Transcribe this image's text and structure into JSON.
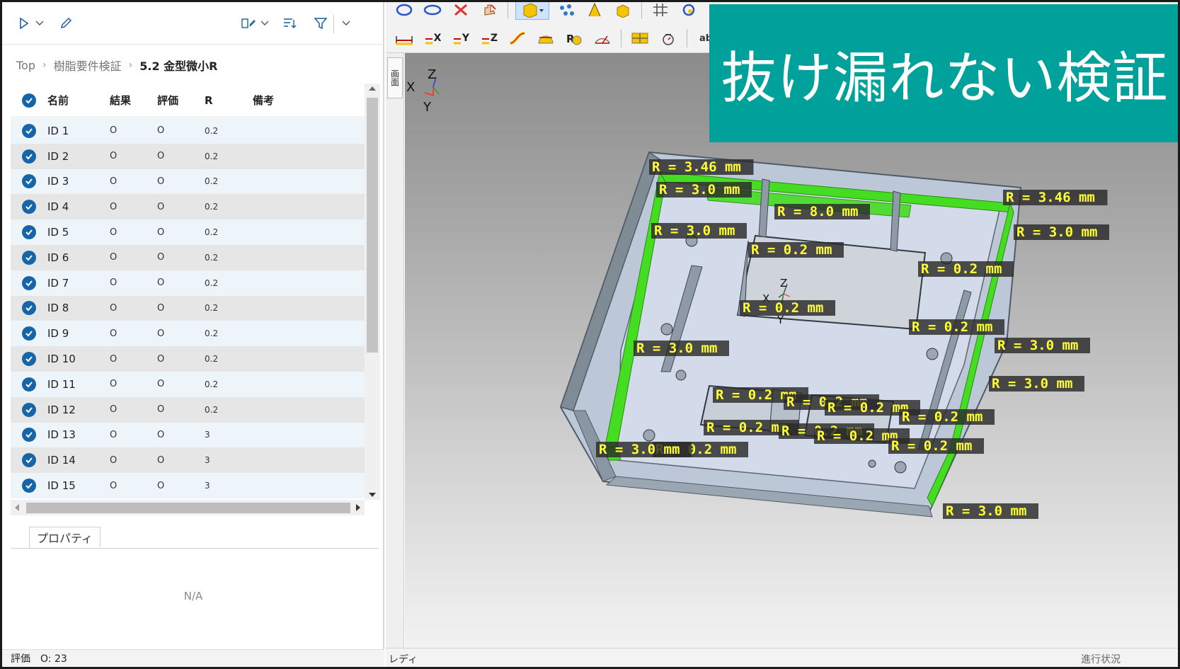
{
  "left_toolbar": {
    "icons": [
      "play-icon",
      "chevron-down-icon",
      "edit-icon",
      "columns-icon",
      "chevron-down-icon",
      "sort-icon",
      "filter-icon",
      "chevron-down-icon"
    ]
  },
  "breadcrumb": {
    "items": [
      "Top",
      "樹脂要件検証",
      "5.2 金型微小R"
    ]
  },
  "grid": {
    "headers": {
      "name": "名前",
      "result": "結果",
      "evaluation": "評価",
      "r": "R",
      "note": "備考"
    },
    "rows": [
      {
        "name": "ID 1",
        "result": "O",
        "evaluation": "O",
        "r": "0.2",
        "note": ""
      },
      {
        "name": "ID 2",
        "result": "O",
        "evaluation": "O",
        "r": "0.2",
        "note": ""
      },
      {
        "name": "ID 3",
        "result": "O",
        "evaluation": "O",
        "r": "0.2",
        "note": ""
      },
      {
        "name": "ID 4",
        "result": "O",
        "evaluation": "O",
        "r": "0.2",
        "note": ""
      },
      {
        "name": "ID 5",
        "result": "O",
        "evaluation": "O",
        "r": "0.2",
        "note": ""
      },
      {
        "name": "ID 6",
        "result": "O",
        "evaluation": "O",
        "r": "0.2",
        "note": ""
      },
      {
        "name": "ID 7",
        "result": "O",
        "evaluation": "O",
        "r": "0.2",
        "note": ""
      },
      {
        "name": "ID 8",
        "result": "O",
        "evaluation": "O",
        "r": "0.2",
        "note": ""
      },
      {
        "name": "ID 9",
        "result": "O",
        "evaluation": "O",
        "r": "0.2",
        "note": ""
      },
      {
        "name": "ID 10",
        "result": "O",
        "evaluation": "O",
        "r": "0.2",
        "note": ""
      },
      {
        "name": "ID 11",
        "result": "O",
        "evaluation": "O",
        "r": "0.2",
        "note": ""
      },
      {
        "name": "ID 12",
        "result": "O",
        "evaluation": "O",
        "r": "0.2",
        "note": ""
      },
      {
        "name": "ID 13",
        "result": "O",
        "evaluation": "O",
        "r": "3",
        "note": ""
      },
      {
        "name": "ID 14",
        "result": "O",
        "evaluation": "O",
        "r": "3",
        "note": ""
      },
      {
        "name": "ID 15",
        "result": "O",
        "evaluation": "O",
        "r": "3",
        "note": ""
      }
    ]
  },
  "properties": {
    "tab_label": "プロパティ",
    "empty_text": "N/A"
  },
  "left_status": "評価　O: 23",
  "cad": {
    "toolbar_row2": [
      "X",
      "Y",
      "Z"
    ],
    "side_tab": "画面",
    "status_left": "レディ",
    "status_right": "進行状況",
    "axis": {
      "x": "X",
      "y": "Y",
      "z": "Z"
    },
    "annotations": [
      "R = 3.46 mm",
      "R = 3.0 mm",
      "R = 8.0 mm",
      "R = 3.0 mm",
      "R = 0.2 mm",
      "R = 3.46 mm",
      "R = 3.0 mm",
      "R = 0.2 mm",
      "R = 0.2 mm",
      "R = 0.2 mm",
      "R = 3.0 mm",
      "R = 3.0 mm",
      "R = 3.0 mm",
      "R = 0.2 mm",
      "R = 0.2 mm",
      "R = 0.2 mm",
      "R = 0.2 mm",
      "R = 0.2 mm",
      "R = 0.2 mm",
      "R = 0.2 mm",
      "R = 0.2 mm",
      "R = 0.2 mm",
      "R = 3.0 mm",
      "R = 3.0 mm"
    ]
  },
  "banner": {
    "text": "抜け漏れない検証",
    "color": "#00a19a"
  },
  "colors": {
    "check": "#1565a8",
    "highlight": "#44dd22",
    "label_text": "#ffff33"
  }
}
